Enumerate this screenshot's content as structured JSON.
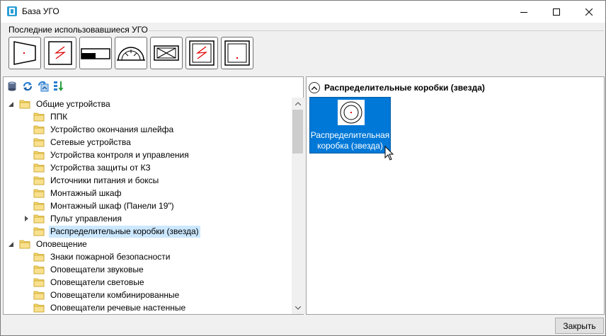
{
  "window": {
    "title": "База УГО",
    "icon": "app-db-icon"
  },
  "recent": {
    "label": "Последние использовавшиеся УГО",
    "symbols": [
      "symbol-trapezoid",
      "symbol-zigzag",
      "symbol-bar-box",
      "symbol-arc-gauge",
      "symbol-cross-box",
      "symbol-zigzag-double",
      "symbol-dot-box"
    ]
  },
  "toolbar": {
    "icons": [
      "database-icon",
      "refresh-icon",
      "sync-icon",
      "sort-icon"
    ]
  },
  "tree": {
    "items": [
      {
        "label": "Общие устройства",
        "level": 0,
        "expander": "expanded"
      },
      {
        "label": "ППК",
        "level": 1,
        "expander": "none"
      },
      {
        "label": "Устройство окончания шлейфа",
        "level": 1,
        "expander": "none"
      },
      {
        "label": "Сетевые устройства",
        "level": 1,
        "expander": "none"
      },
      {
        "label": "Устройства контроля и управления",
        "level": 1,
        "expander": "none"
      },
      {
        "label": "Устройства защиты от КЗ",
        "level": 1,
        "expander": "none"
      },
      {
        "label": "Источники питания и боксы",
        "level": 1,
        "expander": "none"
      },
      {
        "label": "Монтажный шкаф",
        "level": 1,
        "expander": "none"
      },
      {
        "label": "Монтажный шкаф (Панели 19\")",
        "level": 1,
        "expander": "none"
      },
      {
        "label": "Пульт управления",
        "level": 1,
        "expander": "collapsed"
      },
      {
        "label": "Распределительные коробки (звезда)",
        "level": 1,
        "expander": "none",
        "selected": true
      },
      {
        "label": "Оповещение",
        "level": 0,
        "expander": "expanded"
      },
      {
        "label": "Знаки пожарной безопасности",
        "level": 1,
        "expander": "none"
      },
      {
        "label": "Оповещатели звуковые",
        "level": 1,
        "expander": "none"
      },
      {
        "label": "Оповещатели световые",
        "level": 1,
        "expander": "none"
      },
      {
        "label": "Оповещатели комбинированные",
        "level": 1,
        "expander": "none"
      },
      {
        "label": "Оповещатели речевые настенные",
        "level": 1,
        "expander": "none"
      }
    ]
  },
  "gallery": {
    "group_title": "Распределительные коробки (звезда)",
    "tile_label": "Распределительная коробка (звезда)"
  },
  "buttons": {
    "close_label": "Закрыть"
  },
  "colors": {
    "accent": "#0078d7",
    "selection": "#cce8ff",
    "folder": "#f5d76e"
  }
}
